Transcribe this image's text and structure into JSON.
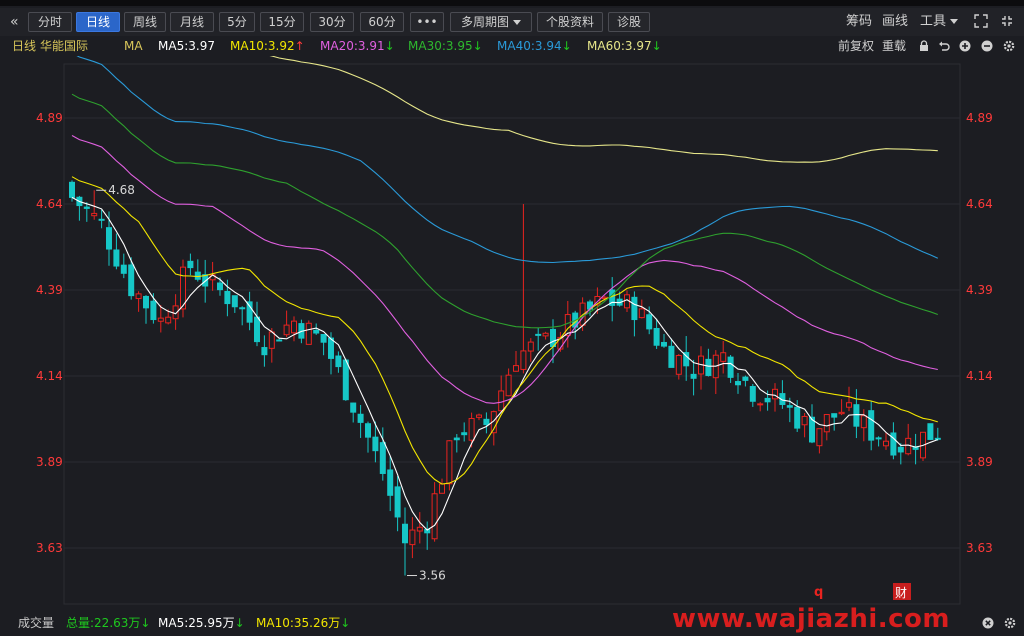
{
  "toolbar": {
    "nav_icon": "double-chevron-left-icon",
    "periods": [
      "分时",
      "日线",
      "周线",
      "月线",
      "5分",
      "15分",
      "30分",
      "60分"
    ],
    "active_period": "日线",
    "more_label": "•••",
    "multi_period_label": "多周期图",
    "stock_info_label": "个股资料",
    "diagnose_label": "诊股",
    "chips_label": "筹码",
    "draw_label": "画线",
    "tools_label": "工具",
    "fullscreen_icon": "expand-icon"
  },
  "ma_row": {
    "period_label": "日线",
    "stock_name": "华能国际",
    "ma_label": "MA",
    "ma5": "MA5:3.97",
    "ma10": "MA10:3.92",
    "ma10_arrow": "↑",
    "ma20": "MA20:3.91",
    "ma20_arrow": "↓",
    "ma30": "MA30:3.95",
    "ma30_arrow": "↓",
    "ma40": "MA40:3.94",
    "ma40_arrow": "↓",
    "ma60": "MA60:3.97",
    "ma60_arrow": "↓",
    "adjust_label": "前复权",
    "reload_label": "重载",
    "icons": [
      "lock-icon",
      "undo-icon",
      "zoom-in-icon",
      "zoom-out-icon",
      "settings-icon"
    ]
  },
  "colors": {
    "up": "#e8231f",
    "down": "#16c7c7",
    "ma5": "#ffffff",
    "ma10": "#f2e600",
    "ma20": "#e060e0",
    "ma30": "#2ea02e",
    "ma40": "#2a9ad8",
    "ma60": "#e6e68a",
    "price_axis": "#ff3a3a"
  },
  "chart_data": {
    "type": "candlestick",
    "y_ticks": [
      "4.89",
      "4.64",
      "4.39",
      "4.14",
      "3.89",
      "3.63"
    ],
    "high_marker": "4.68",
    "low_marker": "3.56",
    "event_markers": [
      "q",
      "财"
    ]
  },
  "volume_row": {
    "label": "成交量",
    "total": "总量:22.63万",
    "total_arrow": "↓",
    "ma5": "MA5:25.95万",
    "ma5_arrow": "↓",
    "ma10": "MA10:35.26万",
    "ma10_arrow": "↓"
  },
  "watermark": "www.wajiazhi.com"
}
